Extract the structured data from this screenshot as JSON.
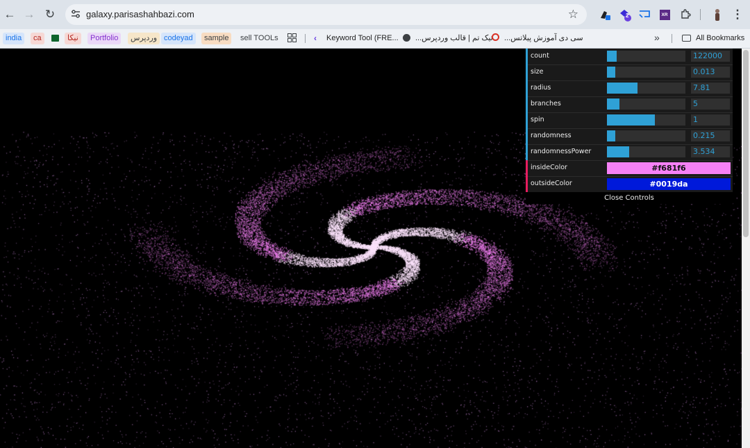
{
  "browser": {
    "url": "galaxy.parisashahbazi.com",
    "extension_badge": "2",
    "xr_label": "XR"
  },
  "bookmarks": {
    "items": [
      {
        "label": "india",
        "color": "#1a73e8",
        "bg": "#d5e5fb"
      },
      {
        "label": "ca",
        "color": "#b3261e",
        "bg": "#f6d8d5"
      },
      {
        "label": "",
        "color": "#0d652d",
        "bg": "#0d652d"
      },
      {
        "label": "نیکا",
        "color": "#b3261e",
        "bg": "#f6d8d5"
      },
      {
        "label": "Portfolio",
        "color": "#8430ce",
        "bg": "#ead8f7"
      },
      {
        "label": "وردپرس",
        "color": "#3c4043",
        "bg": "#f6e6c9"
      },
      {
        "label": "codeyad",
        "color": "#1a73e8",
        "bg": "#d5e5fb"
      },
      {
        "label": "sample",
        "color": "#3c4043",
        "bg": "#f8dcc2"
      },
      {
        "label": "sell TOOLs",
        "color": "#3c4043",
        "bg": "transparent"
      },
      {
        "label": "Keyword Tool (FRE...",
        "color": "#1f1f1f",
        "bg": "transparent"
      },
      {
        "label": "تیک تم | قالب وردپرس...",
        "color": "#1f1f1f",
        "bg": "transparent"
      },
      {
        "label": "سی دی آموزش پیلاتس...",
        "color": "#1f1f1f",
        "bg": "transparent"
      }
    ],
    "all_bookmarks": "All Bookmarks"
  },
  "gui": {
    "controls": [
      {
        "label": "count",
        "value": "122000",
        "fraction": 0.12
      },
      {
        "label": "size",
        "value": "0.013",
        "fraction": 0.11
      },
      {
        "label": "radius",
        "value": "7.81",
        "fraction": 0.39
      },
      {
        "label": "branches",
        "value": "5",
        "fraction": 0.16
      },
      {
        "label": "spin",
        "value": "1",
        "fraction": 0.61
      },
      {
        "label": "randomness",
        "value": "0.215",
        "fraction": 0.11
      },
      {
        "label": "randomnessPower",
        "value": "3.534",
        "fraction": 0.28
      }
    ],
    "colors": [
      {
        "label": "insideColor",
        "value": "#f681f6",
        "text_color": "#111111"
      },
      {
        "label": "outsideColor",
        "value": "#0019da",
        "text_color": "#ffffff"
      }
    ],
    "close_label": "Close Controls"
  },
  "galaxy": {
    "inside_color": "#f681f6",
    "outside_color": "#0019da",
    "star_color": "#c98ad8"
  }
}
